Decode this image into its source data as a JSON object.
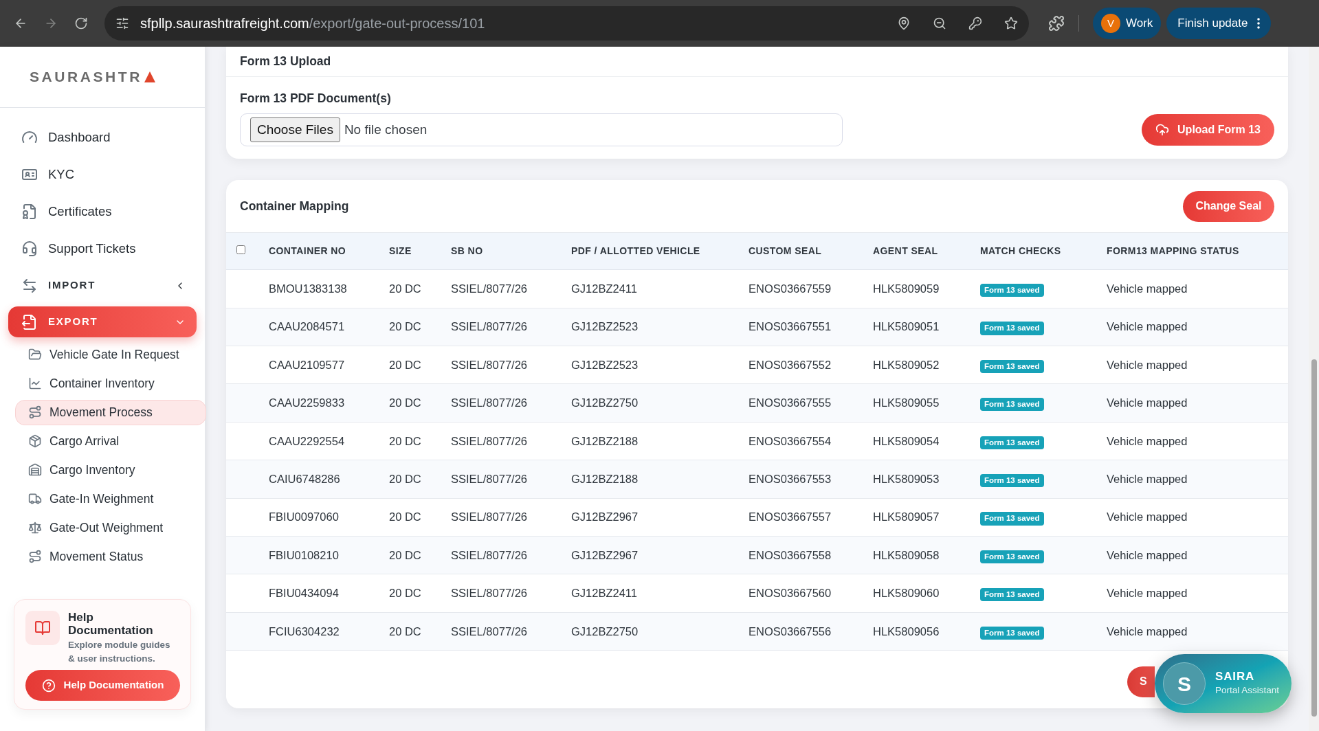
{
  "browser": {
    "url_host": "sfpllp.saurashtrafreight.com",
    "url_path": "/export/gate-out-process/101",
    "profile_initial": "V",
    "profile_name": "Work",
    "update_button": "Finish update"
  },
  "sidebar": {
    "logo": "SAURASHTR",
    "items": [
      {
        "label": "Dashboard",
        "kind": "link",
        "selected": false
      },
      {
        "label": "KYC",
        "kind": "link",
        "selected": false
      },
      {
        "label": "Certificates",
        "kind": "link",
        "selected": false
      },
      {
        "label": "Support Tickets",
        "kind": "link",
        "selected": false
      },
      {
        "label": "IMPORT",
        "kind": "section",
        "selected": false,
        "expanded": false
      },
      {
        "label": "EXPORT",
        "kind": "section",
        "selected": true,
        "expanded": true,
        "children": [
          {
            "label": "Vehicle Gate In Request",
            "selected": false
          },
          {
            "label": "Container Inventory",
            "selected": false
          },
          {
            "label": "Movement Process",
            "selected": true
          },
          {
            "label": "Cargo Arrival",
            "selected": false
          },
          {
            "label": "Cargo Inventory",
            "selected": false
          },
          {
            "label": "Gate-In Weighment",
            "selected": false
          },
          {
            "label": "Gate-Out Weighment",
            "selected": false
          },
          {
            "label": "Movement Status",
            "selected": false
          }
        ]
      }
    ],
    "help": {
      "title": "Help Documentation",
      "description": "Explore module guides & user instructions.",
      "button": "Help Documentation"
    }
  },
  "upload_card": {
    "title": "Form 13 Upload",
    "field_label": "Form 13 PDF Document(s)",
    "file_button": "Choose Files",
    "file_status": "No file chosen",
    "upload_button": "Upload Form 13"
  },
  "mapping_card": {
    "title": "Container Mapping",
    "change_seal_button": "Change Seal",
    "select_all_checked": false,
    "columns": [
      "CONTAINER NO",
      "SIZE",
      "SB NO",
      "PDF / ALLOTTED VEHICLE",
      "CUSTOM SEAL",
      "AGENT SEAL",
      "MATCH CHECKS",
      "FORM13 MAPPING STATUS"
    ],
    "rows": [
      [
        "BMOU1383138",
        "20 DC",
        "SSIEL/8077/26",
        "GJ12BZ2411",
        "ENOS03667559",
        "HLK5809059",
        "Form 13 saved",
        "Vehicle mapped"
      ],
      [
        "CAAU2084571",
        "20 DC",
        "SSIEL/8077/26",
        "GJ12BZ2523",
        "ENOS03667551",
        "HLK5809051",
        "Form 13 saved",
        "Vehicle mapped"
      ],
      [
        "CAAU2109577",
        "20 DC",
        "SSIEL/8077/26",
        "GJ12BZ2523",
        "ENOS03667552",
        "HLK5809052",
        "Form 13 saved",
        "Vehicle mapped"
      ],
      [
        "CAAU2259833",
        "20 DC",
        "SSIEL/8077/26",
        "GJ12BZ2750",
        "ENOS03667555",
        "HLK5809055",
        "Form 13 saved",
        "Vehicle mapped"
      ],
      [
        "CAAU2292554",
        "20 DC",
        "SSIEL/8077/26",
        "GJ12BZ2188",
        "ENOS03667554",
        "HLK5809054",
        "Form 13 saved",
        "Vehicle mapped"
      ],
      [
        "CAIU6748286",
        "20 DC",
        "SSIEL/8077/26",
        "GJ12BZ2188",
        "ENOS03667553",
        "HLK5809053",
        "Form 13 saved",
        "Vehicle mapped"
      ],
      [
        "FBIU0097060",
        "20 DC",
        "SSIEL/8077/26",
        "GJ12BZ2967",
        "ENOS03667557",
        "HLK5809057",
        "Form 13 saved",
        "Vehicle mapped"
      ],
      [
        "FBIU0108210",
        "20 DC",
        "SSIEL/8077/26",
        "GJ12BZ2967",
        "ENOS03667558",
        "HLK5809058",
        "Form 13 saved",
        "Vehicle mapped"
      ],
      [
        "FBIU0434094",
        "20 DC",
        "SSIEL/8077/26",
        "GJ12BZ2411",
        "ENOS03667560",
        "HLK5809060",
        "Form 13 saved",
        "Vehicle mapped"
      ],
      [
        "FCIU6304232",
        "20 DC",
        "SSIEL/8077/26",
        "GJ12BZ2750",
        "ENOS03667556",
        "HLK5809056",
        "Form 13 saved",
        "Vehicle mapped"
      ]
    ],
    "footer_button": "S"
  },
  "assistant": {
    "initial": "S",
    "name": "SAIRA",
    "subtitle": "Portal Assistant"
  }
}
